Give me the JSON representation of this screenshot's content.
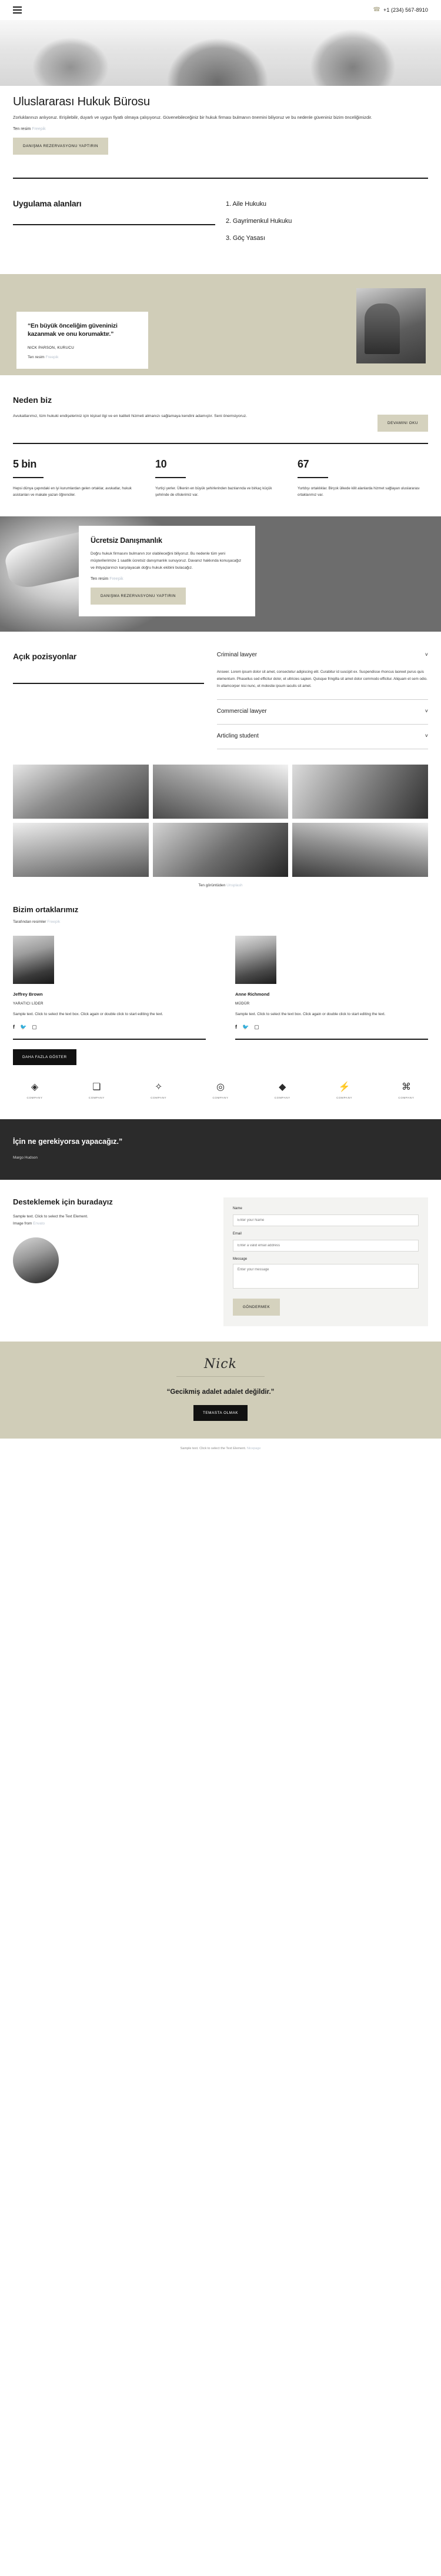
{
  "topbar": {
    "menu_icon": "hamburger-menu-icon",
    "phone_icon": "phone-icon",
    "phone": "+1 (234) 567-8910"
  },
  "hero": {
    "title": "Uluslararası Hukuk Bürosu",
    "body": "Zorluklarınızı anlıyoruz. Erişilebilir, duyarlı ve uygun fiyatlı olmaya çalışıyoruz. Güvenebileceğiniz bir hukuk firması bulmanın önemini biliyoruz ve bu nedenle güveniniz bizim önceliğimizdir.",
    "credit_label": "Ten resim",
    "credit_link": "Freepik",
    "cta": "DANIŞMA REZERVASYONU YAPTIRIN"
  },
  "practice": {
    "title": "Uygulama alanları",
    "items": [
      "1. Aile Hukuku",
      "2. Gayrimenkul Hukuku",
      "3. Göç Yasası"
    ]
  },
  "quote": {
    "text": "“En büyük önceliğim güveninizi kazanmak ve onu korumaktır.”",
    "author": "NICK PARSON, KURUCU",
    "credit_label": "Ten resim",
    "credit_link": "Freepik"
  },
  "why": {
    "title": "Neden biz",
    "body": "Avukatlarımız, tüm hukuki endişeleriniz için kişisel ilgi ve en kaliteli hizmeti almanızı sağlamaya kendini adamıştır. Seni önemsiyoruz.",
    "cta": "DEVAMINI OKU",
    "stats": [
      {
        "num": "5 bin",
        "desc": "Hepsi dünya çapındaki en iyi kurumlardan gelen ortaklar, avukatlar, hukuk asistanları ve makale yazan öğrenciler."
      },
      {
        "num": "10",
        "desc": "Yurtiçi yerler. Ülkenin en büyük şehirlerinden bazılarında ve birkaç küçük şehrinde de ofislerimiz var."
      },
      {
        "num": "67",
        "desc": "Yurtdışı ortaklıklar. Birçok ülkede kilit alanlarda hizmet sağlayan uluslararası ortaklarımız var."
      }
    ]
  },
  "consult": {
    "title": "Ücretsiz Danışmanlık",
    "body": "Doğru hukuk firmasını bulmanın zor olabileceğini biliyoruz. Bu nedenle tüm yeni müşterilerimize 1 saatlik ücretsiz danışmanlık sunuyoruz. Davanız hakkında konuşacağız ve ihtiyaçlarınızı karşılayacak doğru hukuk ekibini bulacağız.",
    "credit_label": "Ten resim",
    "credit_link": "Freepik",
    "cta": "DANIŞMA REZERVASYONU YAPTIRIN"
  },
  "positions": {
    "title": "Açık pozisyonlar",
    "items": [
      {
        "label": "Criminal lawyer",
        "body": "Answer. Lorem ipsum dolor sit amet, consectetur adipiscing elit. Curabitur id suscipit ex. Suspendisse rhoncus laoreet purus quis elementum. Phasellus sed efficitur dolor, et ultricies sapien. Quisque fringilla sit amet dolor commodo efficitur. Aliquam et sem odio. In ullamcorper nisi nunc, et molestie ipsum iaculis sit amet.",
        "chevron": "chevron-down-icon"
      },
      {
        "label": "Commercial lawyer",
        "body": "",
        "chevron": "chevron-down-icon"
      },
      {
        "label": "Articling student",
        "body": "",
        "chevron": "chevron-down-icon"
      }
    ]
  },
  "gallery": {
    "credit_label": "Ten görüntüden",
    "credit_link": "Unsplash"
  },
  "partners": {
    "title": "Bizim ortaklarımız",
    "sub_label": "Tarafından resimler",
    "sub_link": "Freepik",
    "members": [
      {
        "name": "Jeffrey Brown",
        "role": "YARATICI LİDER",
        "text": "Sample text. Click to select the text box. Click again or double click to start editing the text.",
        "social": [
          "facebook-icon",
          "twitter-icon",
          "instagram-icon"
        ]
      },
      {
        "name": "Anne Richmond",
        "role": "MÜDÜR",
        "text": "Sample text. Click to select the text box. Click again or double click to start editing the text.",
        "social": [
          "facebook-icon",
          "twitter-icon",
          "instagram-icon"
        ]
      }
    ],
    "show_more": "DAHA FAZLA GÖSTER"
  },
  "logos": [
    {
      "mark": "◈",
      "cap": "COMPANY"
    },
    {
      "mark": "❏",
      "cap": "COMPANY"
    },
    {
      "mark": "✧",
      "cap": "COMPANY"
    },
    {
      "mark": "◎",
      "cap": "COMPANY"
    },
    {
      "mark": "◆",
      "cap": "COMPANY"
    },
    {
      "mark": "⚡",
      "cap": "COMPANY"
    },
    {
      "mark": "⌘",
      "cap": "COMPANY"
    }
  ],
  "dark_quote": {
    "text": "İçin ne gerekiyorsa yapacağız.”",
    "author": "Margo Hudson"
  },
  "contact": {
    "title": "Desteklemek için buradayız",
    "body": "Sample text. Click to select the Text Element.",
    "image_label": "Image from",
    "image_link": "Envato",
    "form": {
      "name_label": "Name",
      "name_placeholder": "Enter your Name",
      "email_label": "Email",
      "email_placeholder": "Enter a valid email address",
      "message_label": "Message",
      "message_placeholder": "Enter your message",
      "submit": "GÖNDERMEK"
    }
  },
  "signature_band": {
    "signature": "Nick",
    "quote": "“Gecikmiş adalet adalet değildir.”",
    "cta": "TEMASTA OLMAK"
  },
  "footer": {
    "text": "Sample text. Click to select the Text Element.",
    "link": "Nicepage"
  }
}
